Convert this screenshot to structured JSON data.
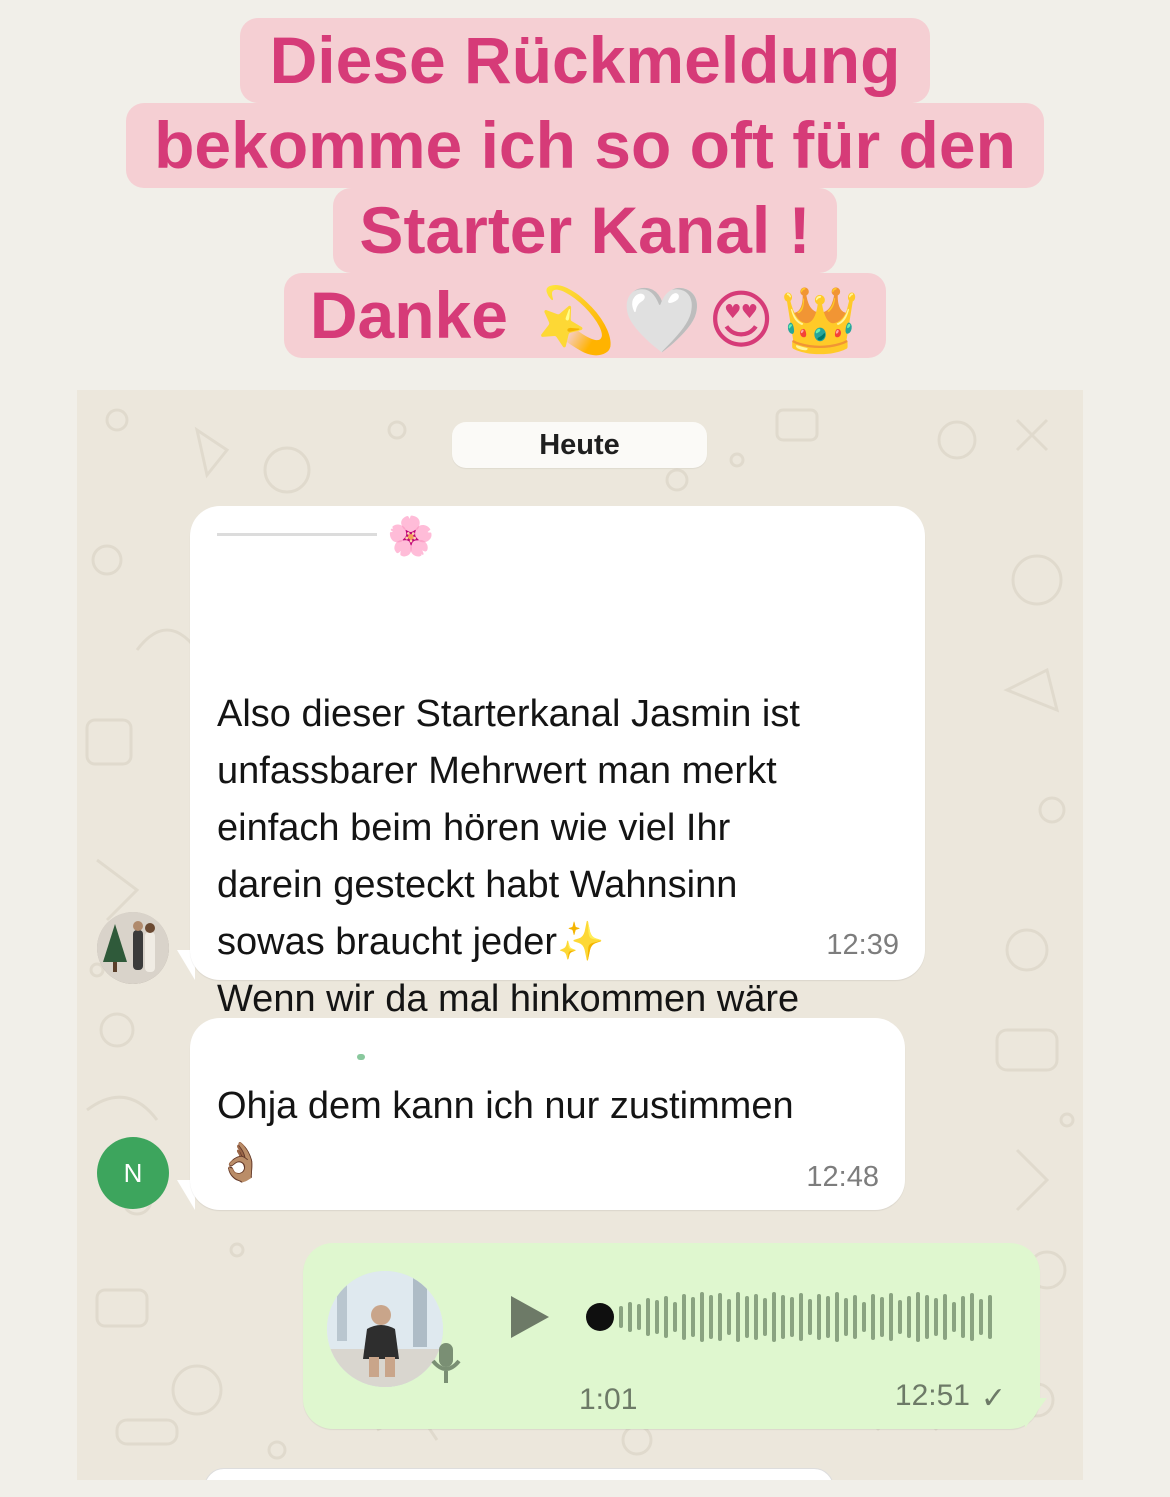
{
  "headline": {
    "line1": "Diese Rückmeldung",
    "line2": "bekomme ich so oft für den",
    "line3": "Starter Kanal !",
    "line4_text": "Danke",
    "line4_emojis": [
      "💫",
      "🤍",
      "😍",
      "👑"
    ]
  },
  "chat": {
    "date_label": "Heute",
    "messages": [
      {
        "sender_emoji": "🌸",
        "text": "Also dieser Starterkanal Jasmin ist\nunfassbarer Mehrwert man merkt\neinfach beim hören wie viel Ihr\ndarein gesteckt habt Wahnsinn\nsowas braucht jeder✨\nWenn wir da mal hinkommen wäre\ndas unglaublich",
        "time": "12:39"
      },
      {
        "text": "Ohja dem kann ich nur zustimmen\n👌🏽",
        "time": "12:48",
        "avatar_initial": "N"
      }
    ],
    "voice_message": {
      "duration": "1:01",
      "time": "12:51",
      "status_icon": "✓"
    }
  },
  "colors": {
    "headline_text": "#d63b78",
    "headline_bg": "#f5cfd3",
    "chat_bg": "#ece7dc",
    "outgoing_bubble": "#dff7cf",
    "avatar_green": "#3da55d"
  }
}
